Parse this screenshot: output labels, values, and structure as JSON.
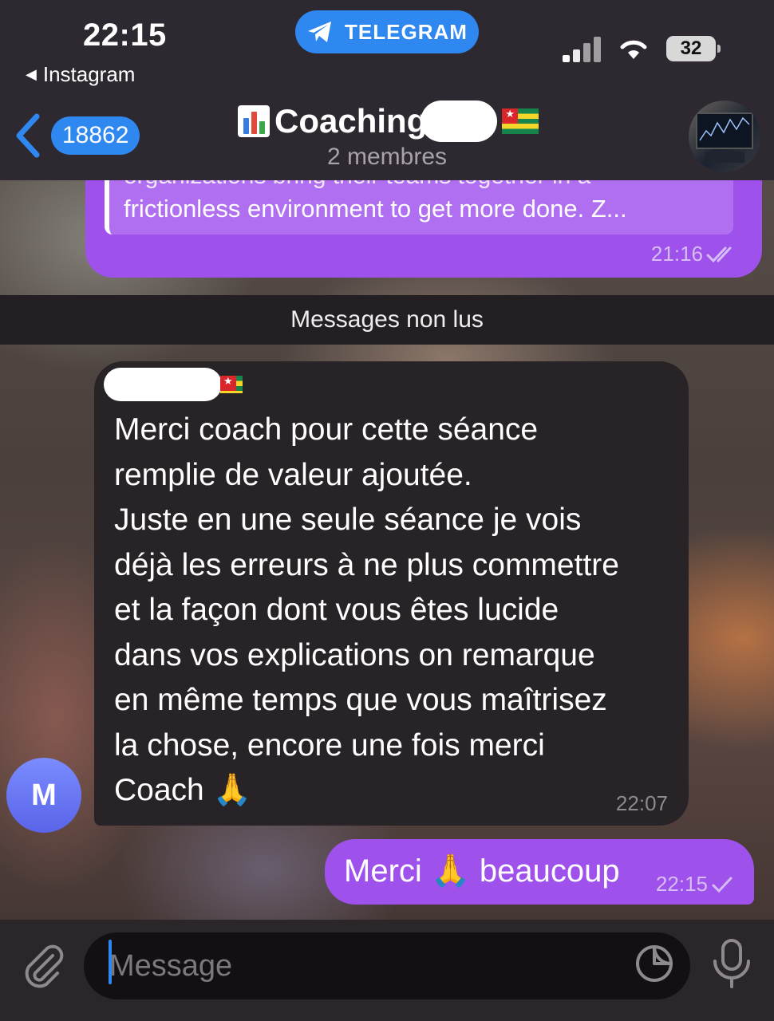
{
  "status_bar": {
    "time": "22:15",
    "back_app": "Instagram",
    "app_pill": "TELEGRAM",
    "battery": "32"
  },
  "header": {
    "back_count": "18862",
    "title": "Coaching",
    "members": "2 membres"
  },
  "messages": {
    "outgoing_preview": {
      "cutoff_line": "organizations bring their teams together in a",
      "text": "frictionless environment to get more done. Z...",
      "time": "21:16"
    },
    "unread_divider": "Messages non lus",
    "incoming": {
      "avatar_initial": "M",
      "text": "Merci coach pour cette séance\nremplie de valeur ajoutée.\nJuste en une seule séance je vois\ndéjà les erreurs à ne plus commettre\net la façon dont vous êtes lucide\ndans vos explications on remarque\nen même temps que vous maîtrisez\nla chose, encore une fois merci\nCoach",
      "emoji": "🙏",
      "time": "22:07"
    },
    "outgoing_reply": {
      "word1": "Merci",
      "emoji": "🙏",
      "word2": "beaucoup",
      "time": "22:15"
    }
  },
  "composer": {
    "placeholder": "Message"
  },
  "colors": {
    "accent": "#2f87f0",
    "outgoing_bubble": "#9f51ec",
    "incoming_bubble": "#272326"
  }
}
